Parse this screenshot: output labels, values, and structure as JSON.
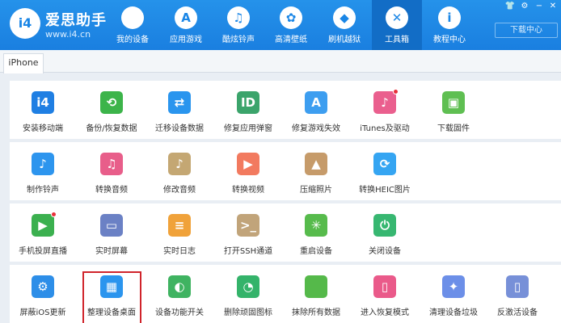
{
  "app": {
    "brand": "爱思助手",
    "site": "www.i4.cn",
    "logo_text": "i4"
  },
  "nav": [
    {
      "label": "我的设备",
      "icon": "apple-icon",
      "glyph": ""
    },
    {
      "label": "应用游戏",
      "icon": "app-store-icon",
      "glyph": "A"
    },
    {
      "label": "酷炫铃声",
      "icon": "bell-icon",
      "glyph": "♫"
    },
    {
      "label": "高清壁纸",
      "icon": "flower-icon",
      "glyph": "✿"
    },
    {
      "label": "刷机越狱",
      "icon": "dropbox-icon",
      "glyph": "◆"
    },
    {
      "label": "工具箱",
      "icon": "tools-icon",
      "glyph": "✕"
    },
    {
      "label": "教程中心",
      "icon": "info-icon",
      "glyph": "i"
    }
  ],
  "download_center": "下载中心",
  "window_controls": [
    "shirt-icon",
    "settings-icon",
    "minimize-icon",
    "close-icon"
  ],
  "tab": {
    "label": "iPhone"
  },
  "rows": [
    [
      {
        "label": "安装移动端",
        "icon": "i4-app-icon",
        "color": "#1f7fe3",
        "glyph": "i4"
      },
      {
        "label": "备份/恢复数据",
        "icon": "backup-clock-icon",
        "color": "#3cb44a",
        "glyph": "⟲"
      },
      {
        "label": "迁移设备数据",
        "icon": "migrate-phones-icon",
        "color": "#2a95ee",
        "glyph": "⇄"
      },
      {
        "label": "修复应用弹窗",
        "icon": "apple-id-icon",
        "color": "#3ba46b",
        "glyph": "ID"
      },
      {
        "label": "修复游戏失效",
        "icon": "app-store-icon",
        "color": "#3d9ef0",
        "glyph": "A"
      },
      {
        "label": "iTunes及驱动",
        "icon": "itunes-icon",
        "color": "#ea5f8e",
        "glyph": "♪",
        "badge": true
      },
      {
        "label": "下载固件",
        "icon": "cube-icon",
        "color": "#5fbf52",
        "glyph": "▣"
      }
    ],
    [
      {
        "label": "制作铃声",
        "icon": "bell-icon",
        "color": "#2d95ee",
        "glyph": "♪"
      },
      {
        "label": "转换音频",
        "icon": "music-note-icon",
        "color": "#e85e8a",
        "glyph": "♫"
      },
      {
        "label": "修改音频",
        "icon": "audio-edit-icon",
        "color": "#c4a773",
        "glyph": "♪"
      },
      {
        "label": "转换视频",
        "icon": "video-play-icon",
        "color": "#f27a5f",
        "glyph": "▶"
      },
      {
        "label": "压缩照片",
        "icon": "photo-icon",
        "color": "#c69b6a",
        "glyph": "▲"
      },
      {
        "label": "转换HEIC图片",
        "icon": "heic-convert-icon",
        "color": "#35a5f2",
        "glyph": "⟳"
      }
    ],
    [
      {
        "label": "手机投屏直播",
        "icon": "screen-cast-icon",
        "color": "#3bb04f",
        "glyph": "▶",
        "badge": true
      },
      {
        "label": "实时屏幕",
        "icon": "monitor-icon",
        "color": "#6b81c5",
        "glyph": "▭"
      },
      {
        "label": "实时日志",
        "icon": "log-icon",
        "color": "#f0a23a",
        "glyph": "≡"
      },
      {
        "label": "打开SSH通道",
        "icon": "terminal-icon",
        "color": "#c1a47a",
        "glyph": ">_"
      },
      {
        "label": "重启设备",
        "icon": "restart-spinner-icon",
        "color": "#57bb4c",
        "glyph": "✳"
      },
      {
        "label": "关闭设备",
        "icon": "power-icon",
        "color": "#37b771",
        "glyph": "⏻"
      }
    ],
    [
      {
        "label": "屏蔽iOS更新",
        "icon": "gear-icon",
        "color": "#2d8ee8",
        "glyph": "⚙"
      },
      {
        "label": "整理设备桌面",
        "icon": "grid-icon",
        "color": "#2b95ee",
        "glyph": "▦"
      },
      {
        "label": "设备功能开关",
        "icon": "toggle-icon",
        "color": "#3fb361",
        "glyph": "◐"
      },
      {
        "label": "删除顽固图标",
        "icon": "pie-chart-icon",
        "color": "#34b36a",
        "glyph": "◔"
      },
      {
        "label": "抹除所有数据",
        "icon": "apple-erase-icon",
        "color": "#55b94a",
        "glyph": ""
      },
      {
        "label": "进入恢复模式",
        "icon": "phone-recovery-icon",
        "color": "#ea5a8a",
        "glyph": "▯"
      },
      {
        "label": "清理设备垃圾",
        "icon": "broom-icon",
        "color": "#6c8fe8",
        "glyph": "✦"
      },
      {
        "label": "反激活设备",
        "icon": "phone-deactivate-icon",
        "color": "#7790d8",
        "glyph": "▯"
      }
    ]
  ]
}
